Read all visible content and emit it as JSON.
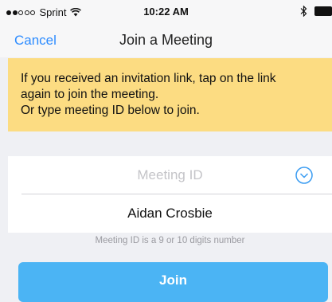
{
  "status_bar": {
    "carrier": "Sprint",
    "time": "10:22 AM",
    "signal_strength": "2 of 5",
    "icons": [
      "wifi-icon",
      "bluetooth-icon",
      "battery-icon"
    ]
  },
  "nav": {
    "cancel_label": "Cancel",
    "title": "Join a Meeting"
  },
  "banner": {
    "line1": "If you received an invitation link, tap on the link",
    "line2": "again to join the meeting.",
    "line3": "Or type meeting ID below to join.",
    "color": "#fcdc82"
  },
  "form": {
    "meeting_id_placeholder": "Meeting ID",
    "meeting_id_value": "",
    "dropdown_icon": "chevron-down-circle-icon",
    "name_value": "Aidan Crosbie",
    "hint": "Meeting ID is a 9 or 10 digits number"
  },
  "join": {
    "label": "Join",
    "color": "#4bb4f4"
  },
  "accent_color": "#2d8cff"
}
